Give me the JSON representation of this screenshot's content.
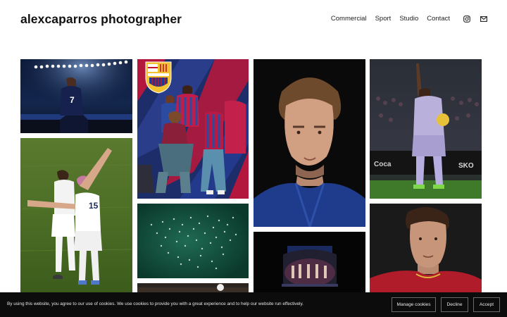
{
  "site": {
    "title": "alexcaparros photographer"
  },
  "nav": {
    "items": [
      {
        "label": "Commercial"
      },
      {
        "label": "Sport"
      },
      {
        "label": "Studio"
      },
      {
        "label": "Contact"
      }
    ],
    "icons": [
      "instagram-icon",
      "mail-icon"
    ]
  },
  "gallery": {
    "photos": [
      {
        "name": "photo-stadium-player",
        "subject": "footballer in dark kit under stadium lights"
      },
      {
        "name": "photo-barca-kit-group",
        "subject": "group of models in blue and red striped kit"
      },
      {
        "name": "photo-portrait-griezmann",
        "subject": "close portrait of man in blue jacket on black"
      },
      {
        "name": "photo-player-pointing-up",
        "subject": "player in lavender kit pointing up holding ball"
      },
      {
        "name": "photo-uswnt-celebration",
        "subject": "two women players in white celebrating on pitch"
      },
      {
        "name": "photo-aerial-crowd",
        "subject": "aerial view of crowd on green field"
      },
      {
        "name": "photo-stadium-night",
        "subject": "stadium facade at night"
      },
      {
        "name": "photo-portrait-red-jersey",
        "subject": "young man in red jersey portrait"
      },
      {
        "name": "photo-ball-match",
        "subject": "ball in air during match"
      }
    ]
  },
  "cookie_banner": {
    "text": "By using this website, you agree to our use of cookies. We use cookies to provide you with a great experience and to help our website run effectively.",
    "manage_label": "Manage cookies",
    "decline_label": "Decline",
    "accept_label": "Accept"
  }
}
